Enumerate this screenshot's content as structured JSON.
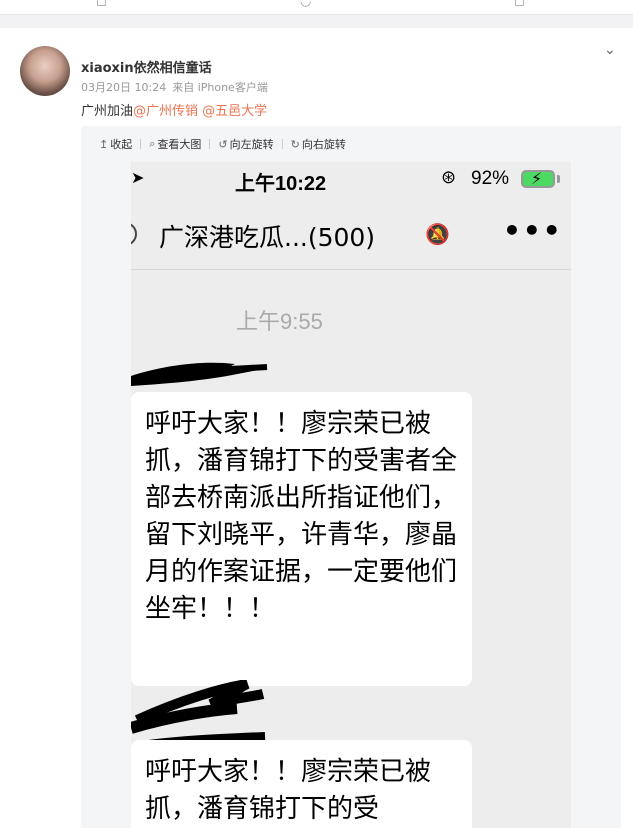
{
  "post": {
    "username": "xiaoxin依然相信童话",
    "date": "03月20日 10:24",
    "source": "来自 iPhone客户端",
    "content_prefix": "广州加油",
    "mentions": [
      "@广州传销",
      "@五邑大学"
    ]
  },
  "toolbar": {
    "items": [
      {
        "icon": "collapse-icon",
        "label": "收起"
      },
      {
        "icon": "zoom-icon",
        "label": "查看大图"
      },
      {
        "icon": "rotate-left-icon",
        "label": "向左旋转"
      },
      {
        "icon": "rotate-right-icon",
        "label": "向右旋转"
      }
    ]
  },
  "phone": {
    "time": "上午10:22",
    "battery_pct": "92%",
    "chat_title": "广深港吃瓜...(500)",
    "timestamp": "上午9:55",
    "messages": [
      "呼吁大家！！廖宗荣已被抓，潘育锦打下的受害者全部去桥南派出所指证他们，留下刘晓平，许青华，廖晶月的作案证据，一定要他们坐牢！！！",
      "呼吁大家！！廖宗荣已被抓，潘育锦打下的受"
    ]
  },
  "colors": {
    "mention": "#eb7350",
    "battery": "#4cd964"
  }
}
